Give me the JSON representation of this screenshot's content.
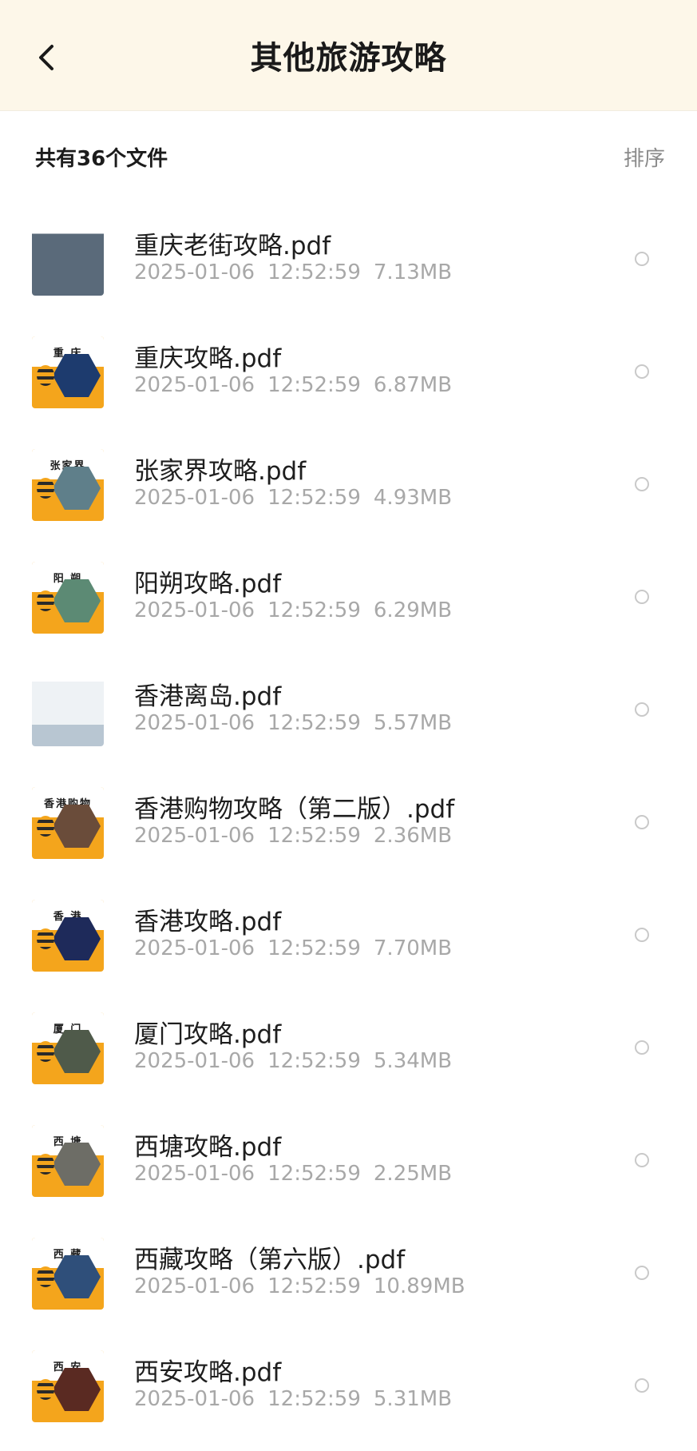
{
  "header": {
    "title": "其他旅游攻略"
  },
  "summary": {
    "count_label": "共有36个文件",
    "sort_label": "排序"
  },
  "files": [
    {
      "name": "重庆老街攻略.pdf",
      "date": "2025-01-06",
      "time": "12:52:59",
      "size": "7.13MB",
      "thumb": "photo"
    },
    {
      "name": "重庆攻略.pdf",
      "date": "2025-01-06",
      "time": "12:52:59",
      "size": "6.87MB",
      "thumb_label": "重 庆",
      "hex_color": "#1d3b6e"
    },
    {
      "name": "张家界攻略.pdf",
      "date": "2025-01-06",
      "time": "12:52:59",
      "size": "4.93MB",
      "thumb_label": "张家界",
      "hex_color": "#5f7f8a"
    },
    {
      "name": "阳朔攻略.pdf",
      "date": "2025-01-06",
      "time": "12:52:59",
      "size": "6.29MB",
      "thumb_label": "阳 朔",
      "hex_color": "#5c8a74"
    },
    {
      "name": "香港离岛.pdf",
      "date": "2025-01-06",
      "time": "12:52:59",
      "size": "5.57MB",
      "thumb": "photo"
    },
    {
      "name": "香港购物攻略（第二版）.pdf",
      "date": "2025-01-06",
      "time": "12:52:59",
      "size": "2.36MB",
      "thumb_label": "香港购物",
      "hex_color": "#6a4c3a"
    },
    {
      "name": "香港攻略.pdf",
      "date": "2025-01-06",
      "time": "12:52:59",
      "size": "7.70MB",
      "thumb_label": "香 港",
      "hex_color": "#1e2a5a"
    },
    {
      "name": "厦门攻略.pdf",
      "date": "2025-01-06",
      "time": "12:52:59",
      "size": "5.34MB",
      "thumb_label": "厦 门",
      "hex_color": "#4f5a4a"
    },
    {
      "name": "西塘攻略.pdf",
      "date": "2025-01-06",
      "time": "12:52:59",
      "size": "2.25MB",
      "thumb_label": "西 塘",
      "hex_color": "#6d6d66"
    },
    {
      "name": "西藏攻略（第六版）.pdf",
      "date": "2025-01-06",
      "time": "12:52:59",
      "size": "10.89MB",
      "thumb_label": "西 藏",
      "hex_color": "#2f4f7a"
    },
    {
      "name": "西安攻略.pdf",
      "date": "2025-01-06",
      "time": "12:52:59",
      "size": "5.31MB",
      "thumb_label": "西 安",
      "hex_color": "#5a2a22"
    }
  ]
}
